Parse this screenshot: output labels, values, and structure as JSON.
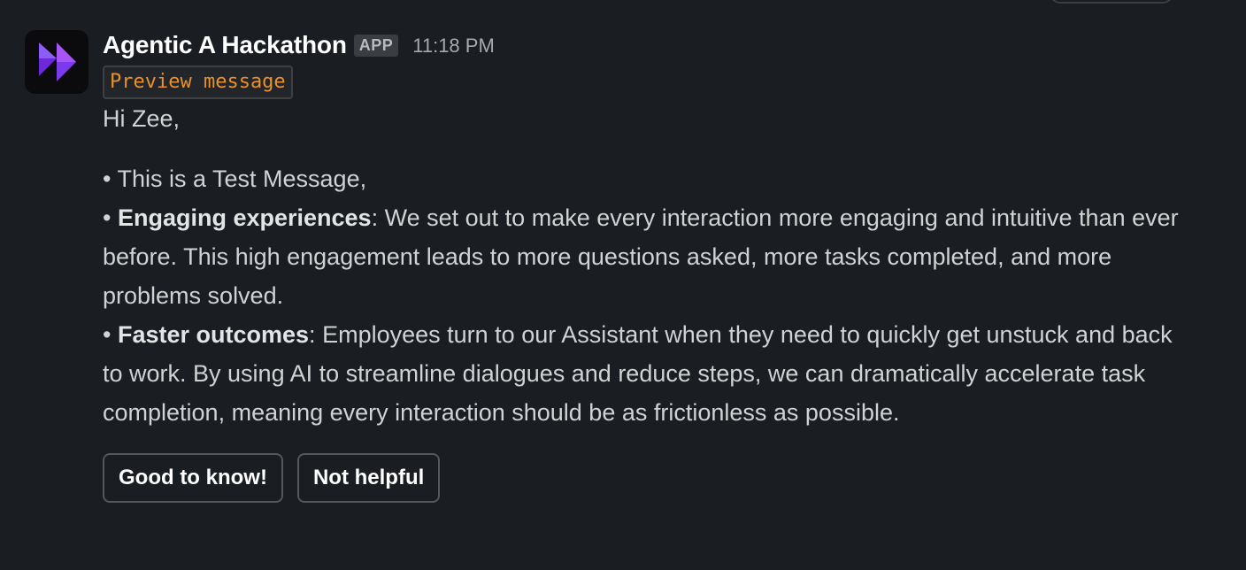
{
  "message": {
    "sender": "Agentic A Hackathon",
    "badge": "APP",
    "timestamp": "11:18 PM",
    "preview_tag": "Preview message",
    "greeting": "Hi Zee,",
    "bullets": [
      {
        "bullet": "•",
        "bold": "",
        "sep": "",
        "text": "This is a Test Message,"
      },
      {
        "bullet": "•",
        "bold": "Engaging experiences",
        "sep": ":",
        "text": "We set out to make every interaction more engaging and intuitive than ever before. This high engagement leads to more questions asked, more tasks completed, and more problems solved."
      },
      {
        "bullet": "•",
        "bold": "Faster outcomes",
        "sep": ":",
        "text": "Employees turn to our Assistant when they need to quickly get unstuck and back to work. By using AI to streamline dialogues and reduce steps, we can dramatically accelerate task completion, meaning every interaction should be as frictionless as possible."
      }
    ],
    "actions": {
      "good": "Good to know!",
      "not_helpful": "Not helpful"
    }
  },
  "colors": {
    "background": "#1a1d21",
    "avatar_bg": "#0b0b0d",
    "logo_purple": "#7c3aed",
    "preview_orange": "#e8912d"
  },
  "icons": {
    "avatar": "fast-forward-logo-icon"
  }
}
